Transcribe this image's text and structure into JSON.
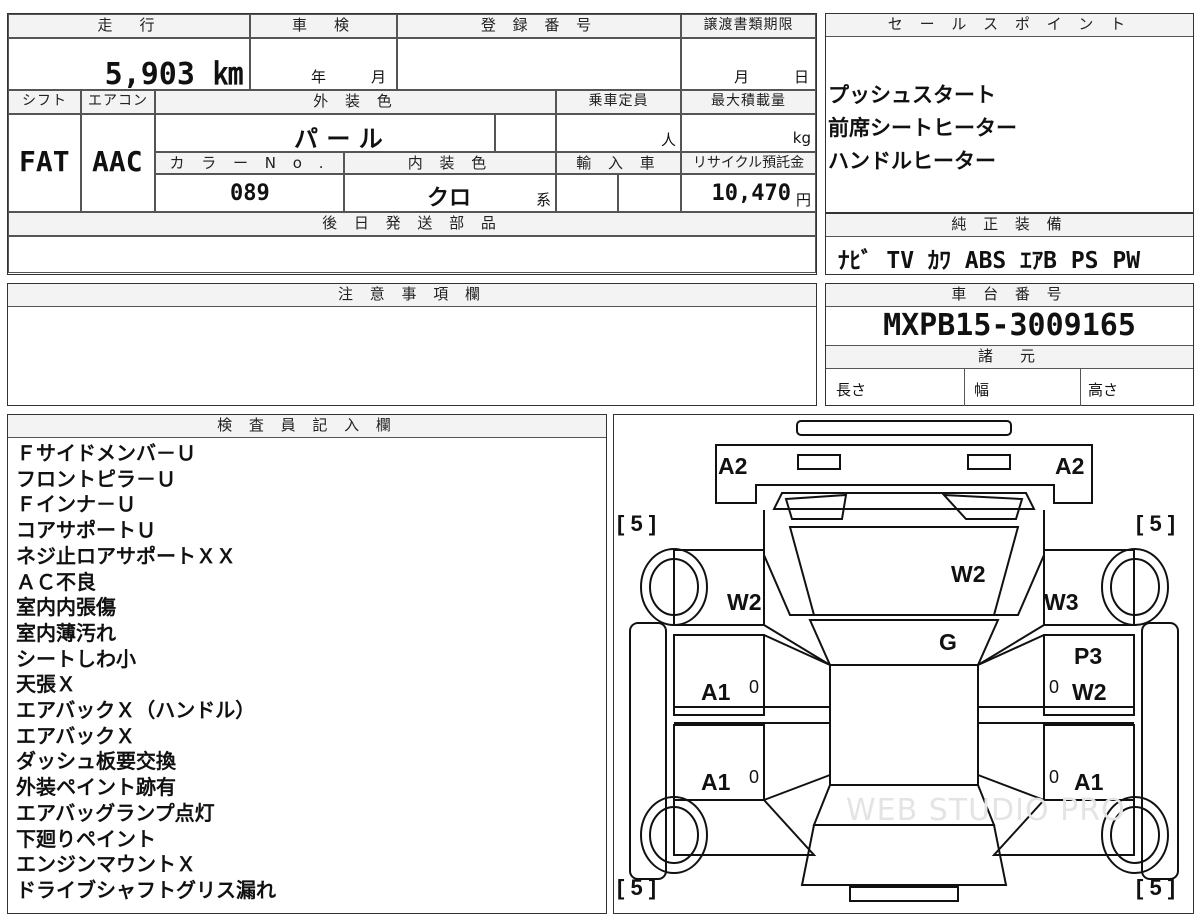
{
  "main": {
    "mileage_header": "走　行",
    "mileage_value": "5,903 ㎞",
    "inspection_header": "車　検",
    "inspection_year": "年",
    "inspection_month": "月",
    "registration_header": "登 録 番 号",
    "transfer_header": "譲渡書類期限",
    "transfer_month": "月",
    "transfer_day": "日",
    "shift_header": "シフト",
    "shift_value": "FAT",
    "ac_header": "エアコン",
    "ac_value": "AAC",
    "exterior_color_header": "外 装 色",
    "exterior_color_value": "パ ー ル",
    "capacity_header": "乗車定員",
    "capacity_unit": "人",
    "max_load_header": "最大積載量",
    "max_load_unit": "kg",
    "color_no_header": "カ ラ ー N o .",
    "color_no_value": "089",
    "interior_color_header": "内 装 色",
    "interior_color_value": "クロ",
    "interior_color_suffix": "系",
    "import_header": "輸 入 車",
    "recycle_header": "リサイクル預託金",
    "recycle_value": "10,470",
    "recycle_unit": "円",
    "later_parts_header": "後 日 発 送 部 品"
  },
  "sales_points": {
    "header": "セ ー ル ス ポ イ ン ト",
    "items": [
      "プッシュスタート",
      "前席シートヒーター",
      "ハンドルヒーター"
    ]
  },
  "equipment": {
    "header": "純 正 装 備",
    "value": "ﾅﾋﾞ TV ｶﾜ ABS ｴｱB PS PW"
  },
  "notes": {
    "header": "注 意 事 項 欄"
  },
  "chassis": {
    "header": "車 台 番 号",
    "value": "MXPB15-3009165"
  },
  "specs": {
    "header": "諸　元",
    "length": "長さ",
    "width": "幅",
    "height": "高さ"
  },
  "inspector": {
    "header": "検 査 員 記 入 欄",
    "remarks": [
      "Ｆサイドメンバ－Ｕ",
      "フロントピラ－Ｕ",
      "Ｆインナ－Ｕ",
      "コアサポートＵ",
      "ネジ止ロアサポートＸＸ",
      "ＡＣ不良",
      "室内内張傷",
      "室内薄汚れ",
      "シートしわ小",
      "天張Ｘ",
      "エアバックＸ（ハンドル）",
      "エアバックＸ",
      "ダッシュ板要交換",
      "外装ペイント跡有",
      "エアバッグランプ点灯",
      "下廻りペイント",
      "エンジンマウントＸ",
      "ドライブシャフトグリス漏れ"
    ]
  },
  "diagram": {
    "marks": {
      "a2_left": "A2",
      "a2_right": "A2",
      "w2_hood": "W2",
      "w2_left_fender": "W2",
      "w3_right_fender": "W3",
      "g_windshield": "G",
      "p3_right_door": "P3",
      "a1_left_front_door": "A1",
      "w2_right_front_door": "W2",
      "a1_left_rear_door": "A1",
      "a1_right_rear_door": "A1",
      "zero_1": "0",
      "zero_2": "0",
      "zero_3": "0",
      "zero_4": "0",
      "tire_fl": "[ 5 ]",
      "tire_fr": "[ 5 ]",
      "tire_rl": "[ 5 ]",
      "tire_rr": "[ 5 ]"
    },
    "watermark": "WEB STUDIO PRO"
  }
}
